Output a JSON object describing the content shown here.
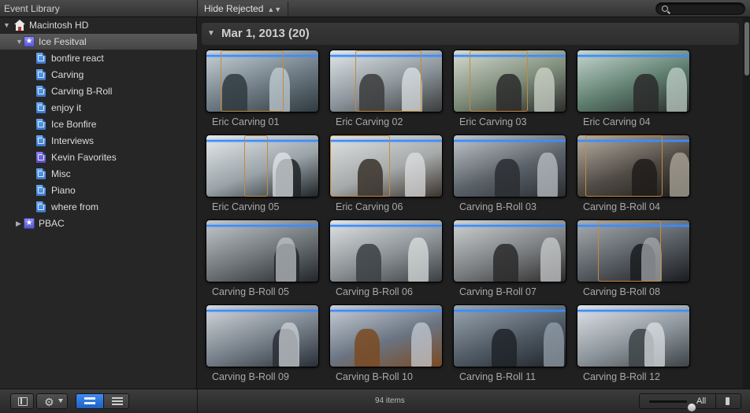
{
  "topbar": {
    "library_title": "Event Library",
    "filter_label": "Hide Rejected",
    "search_placeholder": ""
  },
  "sidebar": {
    "items": [
      {
        "label": "Macintosh HD",
        "icon": "hard-drive-icon",
        "level": 0,
        "expanded": true,
        "selected": false
      },
      {
        "label": "Ice Fesitval",
        "icon": "event-folder-icon",
        "level": 1,
        "expanded": true,
        "selected": true
      },
      {
        "label": "bonfire react",
        "icon": "keyword-collection-icon",
        "level": 2
      },
      {
        "label": "Carving",
        "icon": "keyword-collection-icon",
        "level": 2
      },
      {
        "label": "Carving B-Roll",
        "icon": "keyword-collection-icon",
        "level": 2
      },
      {
        "label": "enjoy it",
        "icon": "keyword-collection-icon",
        "level": 2
      },
      {
        "label": "Ice Bonfire",
        "icon": "keyword-collection-icon",
        "level": 2
      },
      {
        "label": "Interviews",
        "icon": "keyword-collection-icon",
        "level": 2
      },
      {
        "label": "Kevin Favorites",
        "icon": "smart-collection-icon",
        "level": 2
      },
      {
        "label": "Misc",
        "icon": "keyword-collection-icon",
        "level": 2
      },
      {
        "label": "Piano",
        "icon": "keyword-collection-icon",
        "level": 2
      },
      {
        "label": "where from",
        "icon": "keyword-collection-icon",
        "level": 2
      },
      {
        "label": "PBAC",
        "icon": "event-folder-icon",
        "level": 1,
        "expanded": false,
        "selected": false
      }
    ]
  },
  "browser": {
    "group_title": "Mar 1, 2013  (20)",
    "clips": [
      {
        "name": "Eric Carving 01"
      },
      {
        "name": "Eric Carving 02"
      },
      {
        "name": "Eric Carving 03"
      },
      {
        "name": "Eric Carving 04"
      },
      {
        "name": "Eric Carving 05"
      },
      {
        "name": "Eric Carving 06"
      },
      {
        "name": "Carving B-Roll 03"
      },
      {
        "name": "Carving B-Roll 04"
      },
      {
        "name": "Carving B-Roll 05"
      },
      {
        "name": "Carving B-Roll 06"
      },
      {
        "name": "Carving B-Roll 07"
      },
      {
        "name": "Carving B-Roll 08"
      },
      {
        "name": "Carving B-Roll 09"
      },
      {
        "name": "Carving B-Roll 10"
      },
      {
        "name": "Carving B-Roll 11"
      },
      {
        "name": "Carving B-Roll 12"
      }
    ]
  },
  "bottombar": {
    "items_count": "94 items",
    "zoom_label": "All"
  },
  "colors": {
    "accent_blue": "#3b8cff",
    "selection_gray": "#4e4e4e",
    "skim_orange": "#c48a3c"
  }
}
